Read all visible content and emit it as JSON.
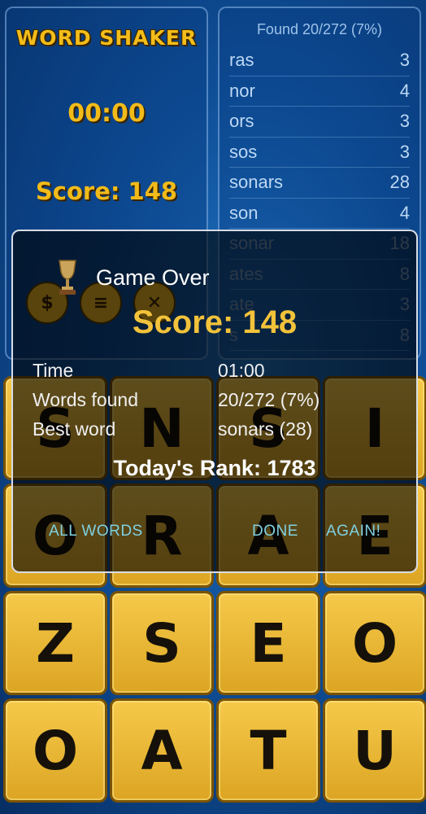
{
  "app": {
    "logo": "WORD SHAKER",
    "timer": "00:00",
    "score_label": "Score: 148"
  },
  "controls": [
    {
      "icon": "dollar-icon",
      "glyph": "$"
    },
    {
      "icon": "menu-icon",
      "glyph": "≡"
    },
    {
      "icon": "close-icon",
      "glyph": "✕"
    }
  ],
  "found_panel": {
    "header": "Found 20/272 (7%)",
    "words": [
      {
        "word": "ras",
        "points": "3"
      },
      {
        "word": "nor",
        "points": "4"
      },
      {
        "word": "ors",
        "points": "3"
      },
      {
        "word": "sos",
        "points": "3"
      },
      {
        "word": "sonars",
        "points": "28"
      },
      {
        "word": "son",
        "points": "4"
      },
      {
        "word": "sonar",
        "points": "18"
      },
      {
        "word": "ates",
        "points": "8"
      },
      {
        "word": "ate",
        "points": "3"
      },
      {
        "word": "s",
        "points": "8"
      }
    ]
  },
  "board": {
    "rows": [
      [
        "S",
        "N",
        "S",
        "I"
      ],
      [
        "O",
        "R",
        "A",
        "E"
      ],
      [
        "Z",
        "S",
        "E",
        "O"
      ],
      [
        "O",
        "A",
        "T",
        "U"
      ]
    ]
  },
  "dialog": {
    "title": "Game Over",
    "score": "Score: 148",
    "stats": [
      {
        "label": "Time",
        "value": "01:00"
      },
      {
        "label": "Words found",
        "value": "20/272 (7%)"
      },
      {
        "label": "Best word",
        "value": "sonars (28)"
      }
    ],
    "rank": "Today's Rank: 1783",
    "buttons": {
      "all_words": "ALL WORDS",
      "done": "DONE",
      "again": "AGAIN!"
    }
  },
  "colors": {
    "gold": "#f2bb19",
    "dialog_score": "#f2c23a",
    "button_text": "#7fd0e0",
    "tile": "#e8b321"
  }
}
